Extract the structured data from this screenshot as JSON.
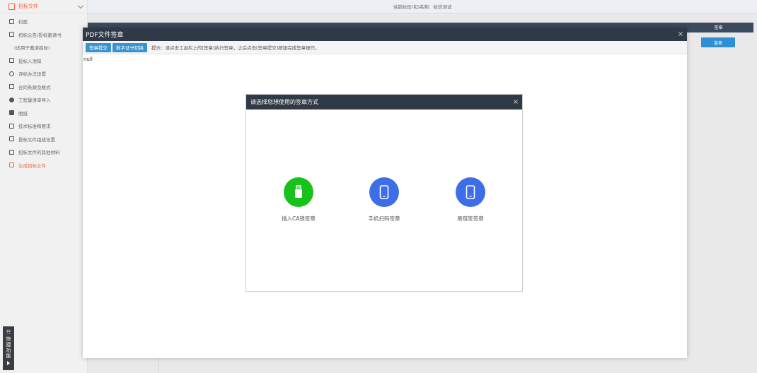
{
  "sidebar": {
    "header": "招标文件",
    "items": [
      {
        "label": "封面",
        "icon": "cover-icon"
      },
      {
        "label": "招标公告/投标邀请书",
        "icon": "notice-icon"
      },
      {
        "label": "(适用于邀请招标)",
        "icon": ""
      },
      {
        "label": "投标人须知",
        "icon": "doc-icon"
      },
      {
        "label": "评标办法设置",
        "icon": "user-icon"
      },
      {
        "label": "合同条款及格式",
        "icon": "contract-icon"
      },
      {
        "label": "工程量清单导入",
        "icon": "gear-icon"
      },
      {
        "label": "图纸",
        "icon": "drawing-icon"
      },
      {
        "label": "技术标准和要求",
        "icon": "standard-icon"
      },
      {
        "label": "投标文件组成设置",
        "icon": "compose-icon"
      },
      {
        "label": "招标文件的其他材料",
        "icon": "material-icon"
      },
      {
        "label": "生成招标文件",
        "icon": "generate-icon"
      }
    ],
    "quick_access": "快捷功能"
  },
  "topbar": {
    "text": "当前标段(包)名称：标信测试"
  },
  "background_table": {
    "sign_header": "签章",
    "sign_button": "盖章"
  },
  "pdf_window": {
    "title": "PDF文件签章",
    "close": "×",
    "toolbar": {
      "submit": "签章提交",
      "switch_cert": "数字证书切换"
    },
    "tip": "提示：请点击工具栏上的[签章]执行签章，之后点击[签章提交]按钮完成签章操作。",
    "content": "null"
  },
  "dialog": {
    "title": "请选择您想使用的签章方式",
    "close": "×",
    "options": [
      {
        "label": "插入CA锁签章",
        "icon": "usb-key-icon",
        "color": "#19c21a"
      },
      {
        "label": "手机扫码签章",
        "icon": "phone-icon",
        "color": "#3d6ee8"
      },
      {
        "label": "易链签签章",
        "icon": "phone-icon",
        "color": "#3d6ee8"
      }
    ]
  },
  "colors": {
    "accent": "#f0663a",
    "titlebar": "#2f3a46",
    "button": "#3a92cf"
  }
}
